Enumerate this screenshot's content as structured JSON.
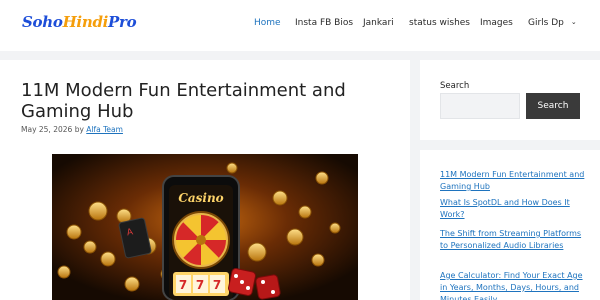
{
  "header": {
    "logo": {
      "part1": "Soho",
      "part2": "Hindi",
      "part3": "Pro"
    },
    "nav": [
      {
        "label": "Home",
        "active": true
      },
      {
        "label": "Insta FB Bios"
      },
      {
        "label": "Jankari"
      },
      {
        "label": "status wishes"
      },
      {
        "label": "Images"
      },
      {
        "label": "Girls Dp",
        "has_dropdown": true
      }
    ],
    "accent_color": "#1e73be"
  },
  "article": {
    "title": "11M Modern Fun Entertainment and Gaming Hub",
    "date": "May 25, 2026",
    "by": "by",
    "author": "Alfa Team",
    "image_text": "Casino"
  },
  "sidebar": {
    "search": {
      "title": "Search",
      "button_label": "Search",
      "value": ""
    },
    "recent_posts": [
      "11M Modern Fun Entertainment and Gaming Hub",
      "What Is SpotDL and How Does It Work?",
      "The Shift from Streaming Platforms to Personalized Audio Libraries",
      "Age Calculator: Find Your Exact Age in Years, Months, Days, Hours, and Minutes Easily"
    ]
  }
}
